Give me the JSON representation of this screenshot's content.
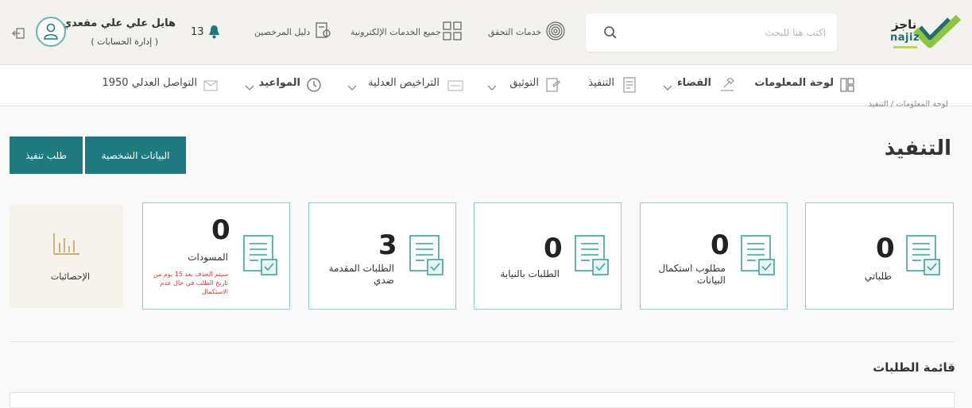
{
  "brand": {
    "logo_ar": "ناجز",
    "logo_en": "najiz"
  },
  "colors": {
    "primary": "#1f7a80",
    "card_border": "#8fd1cc",
    "warning_text": "#d33c3c",
    "logo_green": "#8cc63f"
  },
  "search": {
    "placeholder": "اكتب هنا للبحث",
    "icon": "search-icon"
  },
  "top_links": [
    {
      "label": "خدمات التحقق",
      "icon": "fingerprint-icon"
    },
    {
      "label": "جميع الخدمات الإلكترونية",
      "icon": "grid-icon"
    },
    {
      "label": "دليل المرخصين",
      "icon": "license-guide-icon"
    }
  ],
  "notifications": {
    "count": "13",
    "icon": "bell-icon"
  },
  "user": {
    "name": "هايل علي علي مقعدي",
    "subtitle": "( إدارة الحسابات )",
    "icon": "user-icon"
  },
  "logout": {
    "icon": "logout-icon"
  },
  "nav": [
    {
      "label": "لوحة المعلومات",
      "icon": "dashboard-icon",
      "has_dropdown": false
    },
    {
      "label": "القضاء",
      "icon": "judiciary-icon",
      "has_dropdown": true
    },
    {
      "label": "التنفيذ",
      "icon": "execution-icon",
      "has_dropdown": false
    },
    {
      "label": "التوثيق",
      "icon": "documentation-icon",
      "has_dropdown": true
    },
    {
      "label": "التراخيص العدلية",
      "icon": "license-icon",
      "has_dropdown": true
    },
    {
      "label": "المواعيد",
      "icon": "clock-icon",
      "has_dropdown": true
    },
    {
      "label": "التواصل العدلي 1950",
      "icon": "contact-icon",
      "has_dropdown": false
    }
  ],
  "breadcrumb": "لوحة المعلومات  /  التنفيذ",
  "page_title": "التنفيذ",
  "actions": {
    "personal_data": "البيانات الشخصية",
    "execution_request": "طلب تنفيذ"
  },
  "cards": [
    {
      "count": "0",
      "label": "طلباتي",
      "icon": "document-check-icon"
    },
    {
      "count": "0",
      "label": "مطلوب استكمال البيانات",
      "icon": "document-check-icon"
    },
    {
      "count": "0",
      "label": "الطلبات بالنيابة",
      "icon": "document-check-icon"
    },
    {
      "count": "3",
      "label": "الطلبات المقدمة ضدي",
      "icon": "document-check-icon"
    },
    {
      "count": "0",
      "label": "المسودات",
      "note": "سيتم الحذف بعد 15 يوم من تاريخ الطلب في حال عدم الاستكمال",
      "icon": "document-check-icon"
    }
  ],
  "stats": {
    "label": "الإحصائيات",
    "icon": "bar-chart-icon"
  },
  "requests_list": {
    "title": "قائمة الطلبات"
  }
}
